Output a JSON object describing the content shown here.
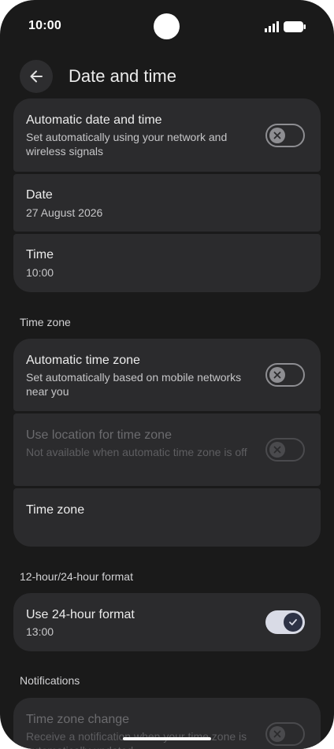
{
  "status_bar": {
    "time": "10:00"
  },
  "header": {
    "title": "Date and time"
  },
  "date_time_card": {
    "auto_title": "Automatic date and time",
    "auto_subtitle": "Set automatically using your network and wireless signals",
    "auto_toggle": "off",
    "date_title": "Date",
    "date_value": "27 August 2026",
    "time_title": "Time",
    "time_value": "10:00"
  },
  "time_zone_section": {
    "label": "Time zone",
    "auto_title": "Automatic time zone",
    "auto_subtitle": "Set automatically based on mobile networks near you",
    "auto_toggle": "off",
    "location_title": "Use location for time zone",
    "location_subtitle": "Not available when automatic time zone is off",
    "location_toggle": "off",
    "zone_title": "Time zone"
  },
  "format_section": {
    "label": "12-hour/24-hour format",
    "use24_title": "Use 24-hour format",
    "use24_value": "13:00",
    "use24_toggle": "on"
  },
  "notifications_section": {
    "label": "Notifications",
    "change_title": "Time zone change",
    "change_subtitle": "Receive a notification when your time zone is automatically updated",
    "change_toggle": "off"
  },
  "colors": {
    "background": "#1a1a1a",
    "card": "#2b2b2d",
    "toggle_on": "#d9dbe6"
  },
  "icons": [
    "back-arrow-icon",
    "close-icon",
    "check-icon",
    "signal-icon",
    "battery-icon"
  ]
}
